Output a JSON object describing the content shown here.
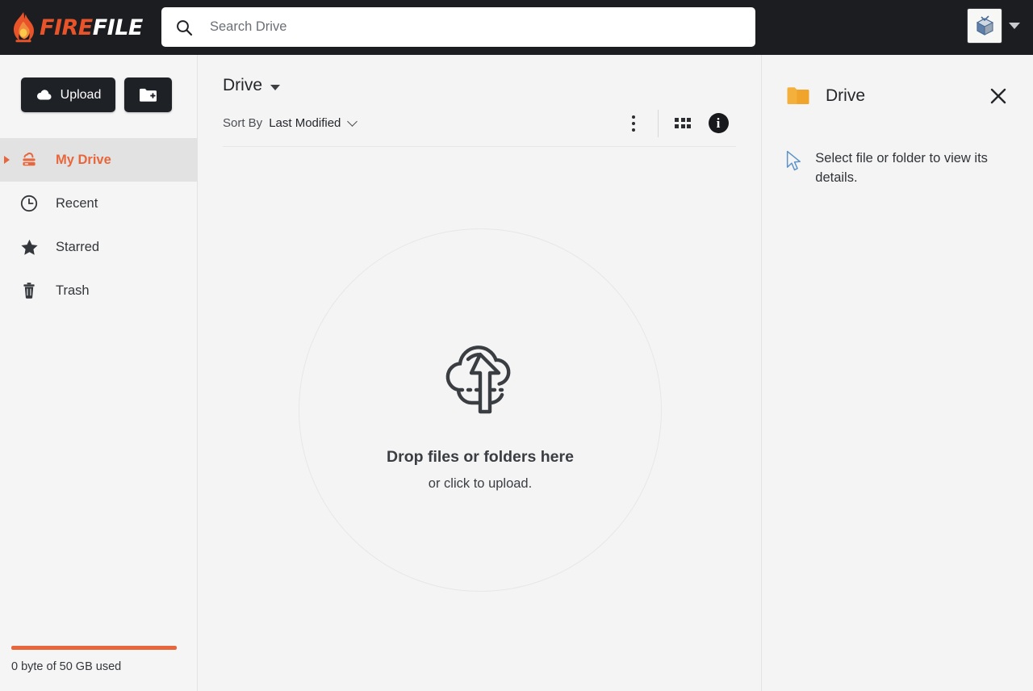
{
  "app": {
    "brand_fire": "FIRE",
    "brand_file": "FILE",
    "accent_color": "#e8663c",
    "header_bg": "#1b1d21",
    "folder_color": "#f4b03c"
  },
  "header": {
    "logo_icon": "flame-icon",
    "search": {
      "icon": "search-icon",
      "value": "",
      "placeholder": "Search Drive"
    },
    "avatar_icon": "user-avatar",
    "account_caret_icon": "caret-down-icon"
  },
  "sidebar": {
    "upload_button": {
      "label": "Upload",
      "icon": "cloud-upload-icon"
    },
    "new_folder_button": {
      "label": "",
      "icon": "folder-add-icon"
    },
    "items": [
      {
        "label": "My Drive",
        "icon": "drive-icon",
        "active": true,
        "expander": "caret-right-icon"
      },
      {
        "label": "Recent",
        "icon": "clock-icon",
        "active": false
      },
      {
        "label": "Starred",
        "icon": "star-icon",
        "active": false
      },
      {
        "label": "Trash",
        "icon": "trash-icon",
        "active": false
      }
    ],
    "storage": {
      "label": "0 byte of 50 GB used",
      "percent": 100,
      "bar_color": "#e8663c"
    }
  },
  "main": {
    "breadcrumb": "Drive",
    "breadcrumb_caret_icon": "caret-down-icon",
    "toolbar": {
      "sort_by_label": "Sort By",
      "sort_value": "Last Modified",
      "sort_caret_icon": "chevron-down-icon",
      "more_icon": "kebab-menu-icon",
      "grid_view_icon": "grid-view-icon",
      "info_icon": "info-icon"
    },
    "dropzone": {
      "icon": "cloud-upload-icon",
      "title": "Drop files or folders here",
      "subtitle": "or click to upload."
    }
  },
  "details": {
    "folder_icon": "folder-icon",
    "title": "Drive",
    "close_icon": "close-icon",
    "cursor_icon": "mouse-pointer-icon",
    "empty_message": "Select file or folder to view its details."
  }
}
